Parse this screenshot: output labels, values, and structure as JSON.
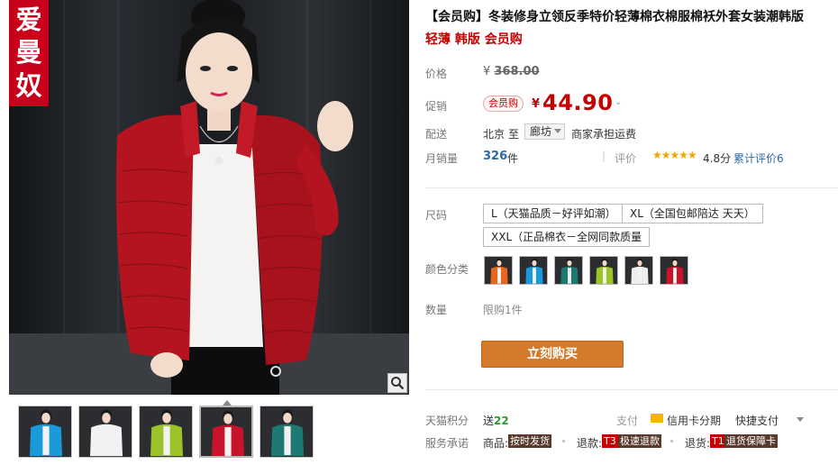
{
  "gallery": {
    "brand_chars": [
      "爱",
      "曼",
      "奴"
    ],
    "zoom_icon": "magnifier-icon",
    "thumbnails": [
      {
        "color": "#1a9ad8",
        "name": "blue"
      },
      {
        "color": "#f2f2f2",
        "name": "white"
      },
      {
        "color": "#9cc42a",
        "name": "green"
      },
      {
        "color": "#c8142a",
        "name": "red"
      },
      {
        "color": "#1d7a72",
        "name": "teal"
      }
    ],
    "active_thumbnail": 3
  },
  "product": {
    "title_line1": "【会员购】冬装修身立领反季特价轻薄棉衣棉服棉袄外套女装潮韩版",
    "title_line2": "轻薄 韩版 会员购"
  },
  "price": {
    "label": "价格",
    "yen": "¥",
    "original": "368.00",
    "promo_label": "促销",
    "promo_badge": "会员购",
    "promo_yen": "¥",
    "promo_price": "44.90"
  },
  "shipping": {
    "label": "配送",
    "from": "北京",
    "to": "至",
    "dest": "廊坊",
    "fee": "商家承担运费"
  },
  "sales": {
    "label": "月销量",
    "count": "326",
    "unit": "件",
    "rating_label": "评价",
    "stars": "★★★★★",
    "score": "4.8分",
    "total": "累计评价6"
  },
  "size": {
    "label": "尺码",
    "options": [
      "L（天猫品质－好评如潮）",
      "XL（全国包邮陪达 天天）",
      "XXL（正品棉衣－全网同款质量"
    ]
  },
  "colors": {
    "label": "颜色分类",
    "swatches": [
      {
        "color": "#e8661a",
        "name": "orange"
      },
      {
        "color": "#1a9ad8",
        "name": "blue"
      },
      {
        "color": "#1d7a72",
        "name": "teal"
      },
      {
        "color": "#9cc42a",
        "name": "green"
      },
      {
        "color": "#eeeeee",
        "name": "white"
      },
      {
        "color": "#c8142a",
        "name": "red"
      }
    ]
  },
  "quantity": {
    "label": "数量",
    "value": "限购1件"
  },
  "buy_button": "立刻购买",
  "points": {
    "label": "天猫积分",
    "prefix": "送",
    "value": "22"
  },
  "payment": {
    "label": "支付",
    "credit": "信用卡分期",
    "fast": "快捷支付"
  },
  "service": {
    "label": "服务承诺",
    "item1_prefix": "商品:",
    "item1_tag": "按时发货",
    "item2_prefix": "退款:",
    "item2_code": "T3",
    "item2_tag": "极速退款",
    "item3_prefix": "退货:",
    "item3_code": "T1",
    "item3_tag": "退货保障卡"
  }
}
